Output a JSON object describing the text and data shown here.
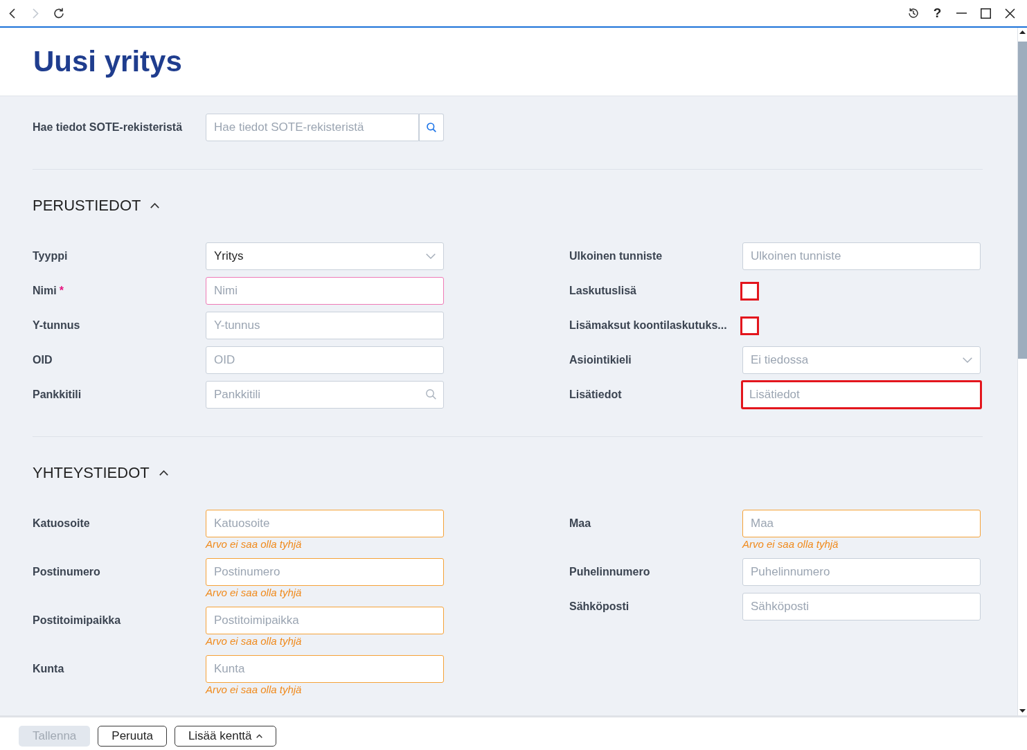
{
  "browser_bar": {
    "nav": [
      {
        "kind": "back",
        "disabled": false
      },
      {
        "kind": "forward",
        "disabled": true
      },
      {
        "kind": "reload",
        "disabled": false
      }
    ],
    "actions": [
      {
        "kind": "history"
      },
      {
        "kind": "help",
        "label": "?"
      },
      {
        "kind": "minimize"
      },
      {
        "kind": "maximize"
      },
      {
        "kind": "close"
      }
    ]
  },
  "page": {
    "title": "Uusi yritys"
  },
  "lookup": {
    "label": "Hae tiedot SOTE-rekisteristä",
    "placeholder": "Hae tiedot SOTE-rekisteristä"
  },
  "required_marker": "*",
  "sections": [
    {
      "title": "PERUSTIEDOT",
      "expanded": true,
      "left": [
        {
          "kind": "select",
          "label": "Tyyppi",
          "value": "Yritys",
          "required": false,
          "highlighted": false
        },
        {
          "kind": "text",
          "label": "Nimi",
          "placeholder": "Nimi",
          "required": true,
          "highlighted": false
        },
        {
          "kind": "text",
          "label": "Y-tunnus",
          "placeholder": "Y-tunnus",
          "required": false,
          "highlighted": false
        },
        {
          "kind": "text",
          "label": "OID",
          "placeholder": "OID",
          "required": false,
          "highlighted": false
        },
        {
          "kind": "search",
          "label": "Pankkitili",
          "placeholder": "Pankkitili",
          "required": false,
          "highlighted": false
        }
      ],
      "right": [
        {
          "kind": "text",
          "label": "Ulkoinen tunniste",
          "placeholder": "Ulkoinen tunniste",
          "required": false,
          "highlighted": false
        },
        {
          "kind": "checkbox",
          "label": "Laskutuslisä",
          "checked": false,
          "required": false,
          "highlighted": true
        },
        {
          "kind": "checkbox",
          "label": "Lisämaksut koontilaskutuks...",
          "checked": false,
          "required": false,
          "highlighted": true
        },
        {
          "kind": "select",
          "label": "Asiointikieli",
          "placeholder": "Ei tiedossa",
          "required": false,
          "highlighted": false
        },
        {
          "kind": "text",
          "label": "Lisätiedot",
          "placeholder": "Lisätiedot",
          "required": false,
          "highlighted": true
        }
      ]
    },
    {
      "title": "YHTEYSTIEDOT",
      "expanded": true,
      "left": [
        {
          "kind": "text",
          "label": "Katuosoite",
          "placeholder": "Katuosoite",
          "required": false,
          "highlighted": false,
          "error": "Arvo ei saa olla tyhjä"
        },
        {
          "kind": "text",
          "label": "Postinumero",
          "placeholder": "Postinumero",
          "required": false,
          "highlighted": false,
          "error": "Arvo ei saa olla tyhjä"
        },
        {
          "kind": "text",
          "label": "Postitoimipaikka",
          "placeholder": "Postitoimipaikka",
          "required": false,
          "highlighted": false,
          "error": "Arvo ei saa olla tyhjä"
        },
        {
          "kind": "text",
          "label": "Kunta",
          "placeholder": "Kunta",
          "required": false,
          "highlighted": false,
          "error": "Arvo ei saa olla tyhjä"
        }
      ],
      "right": [
        {
          "kind": "text",
          "label": "Maa",
          "placeholder": "Maa",
          "required": false,
          "highlighted": false,
          "error": "Arvo ei saa olla tyhjä"
        },
        {
          "kind": "text",
          "label": "Puhelinnumero",
          "placeholder": "Puhelinnumero",
          "required": false,
          "highlighted": false
        },
        {
          "kind": "text",
          "label": "Sähköposti",
          "placeholder": "Sähköposti",
          "required": false,
          "highlighted": false
        }
      ]
    }
  ],
  "footer": {
    "buttons": [
      {
        "label": "Tallenna",
        "disabled": true,
        "has_menu": false
      },
      {
        "label": "Peruuta",
        "disabled": false,
        "has_menu": false
      },
      {
        "label": "Lisää kenttä",
        "disabled": false,
        "has_menu": true
      }
    ]
  }
}
